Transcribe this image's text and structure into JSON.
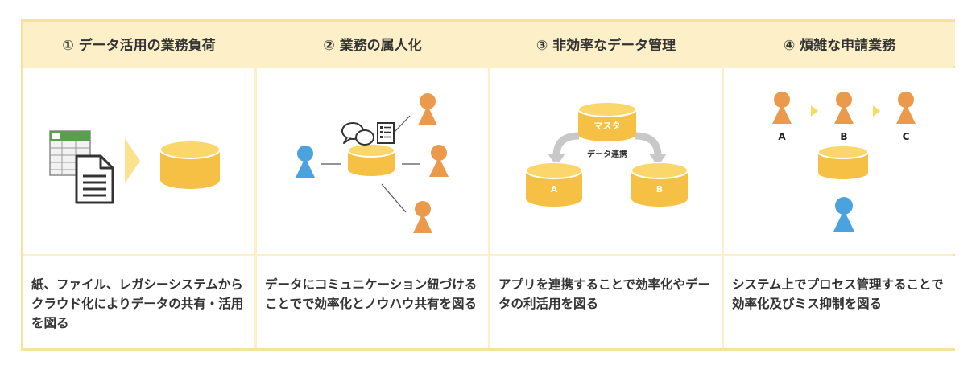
{
  "columns": [
    {
      "title": "① データ活用の業務負荷",
      "description": "紙、ファイル、レガシーシステムからクラウド化によりデータの共有・活用を図る"
    },
    {
      "title": "② 業務の属人化",
      "description": "データにコミュニケーション紐づけることでで効率化とノウハウ共有を図る"
    },
    {
      "title": "③ 非効率なデータ管理",
      "description": "アプリを連携することで効率化やデータの利活用を図る",
      "diagram": {
        "master_label": "マスタ",
        "link_label": "データ連携",
        "db_a_label": "A",
        "db_b_label": "B"
      }
    },
    {
      "title": "④ 煩雑な申請業務",
      "description": "システム上でプロセス管理することで効率化及びミス抑制を図る",
      "diagram": {
        "step_a": "A",
        "step_b": "B",
        "step_c": "C"
      }
    }
  ],
  "colors": {
    "panel_border": "#f7e29a",
    "header_bg": "#fdf0c9",
    "database": "#f5c044",
    "database_top": "#fbd66a",
    "person_orange": "#eb9a4c",
    "person_blue": "#4aa3df",
    "arrow_yellow": "#fbe28f",
    "arrow_grey": "#c8c8c8"
  },
  "icons": [
    "spreadsheet-icon",
    "document-icon",
    "arrow-right-icon",
    "database-icon",
    "person-icon",
    "chat-bubbles-icon",
    "checklist-icon"
  ]
}
